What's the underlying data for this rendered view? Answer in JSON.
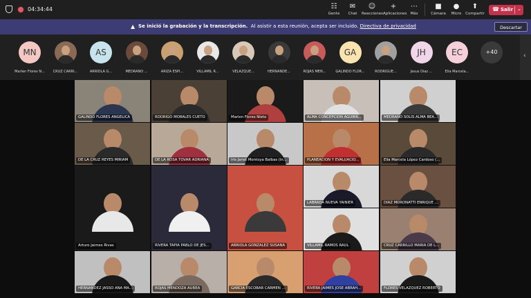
{
  "topbar": {
    "timer": "04:34:44",
    "controls": [
      {
        "label": "Gente",
        "glyph": "☷"
      },
      {
        "label": "Chat",
        "glyph": "✉"
      },
      {
        "label": "Reacciones",
        "glyph": "☺"
      },
      {
        "label": "Aplicaciones",
        "glyph": "+"
      },
      {
        "label": "Más",
        "glyph": "⋯"
      },
      {
        "label": "Cámara",
        "glyph": "■"
      },
      {
        "label": "Micro",
        "glyph": "●"
      },
      {
        "label": "Compartir",
        "glyph": "⬆"
      }
    ],
    "leave_label": "Salir"
  },
  "banner": {
    "bold": "Se inició la grabación y la transcripción.",
    "text": "Al asistir a esta reunión, acepta ser incluido.",
    "link": "Directiva de privacidad",
    "dismiss": "Descartar"
  },
  "strip": {
    "participants": [
      {
        "initials": "MN",
        "name": "Marlen Flores N...",
        "color": "#f4c7c3"
      },
      {
        "initials": "",
        "name": "CRUZ CARRI...",
        "color": "#8a6a55"
      },
      {
        "initials": "AS",
        "name": "ARRIOLA G...",
        "color": "#c7e3ec"
      },
      {
        "initials": "",
        "name": "MEDRANO ...",
        "color": "#6a4a3a"
      },
      {
        "initials": "",
        "name": "ARIZA ESPI...",
        "color": "#c9a070"
      },
      {
        "initials": "",
        "name": "VILLAMIL R...",
        "color": "#e8e8e8"
      },
      {
        "initials": "",
        "name": "VELAZQUE...",
        "color": "#d8c8b8"
      },
      {
        "initials": "",
        "name": "HERNANDE...",
        "color": "#3a3a3a"
      },
      {
        "initials": "",
        "name": "ROJAS MEN...",
        "color": "#c85a5a"
      },
      {
        "initials": "GA",
        "name": "GALINDO FLOR...",
        "color": "#f9e3b0"
      },
      {
        "initials": "",
        "name": "RODRIGUE...",
        "color": "#a0a0a0"
      },
      {
        "initials": "JH",
        "name": "Jesus Diaz ...",
        "color": "#f1d5e8"
      },
      {
        "initials": "EC",
        "name": "Elia Marcela...",
        "color": "#f5d0d8"
      }
    ],
    "more": "+40"
  },
  "tiles": [
    {
      "name": "GALINDO FLORES ANGELICA",
      "bg": "#8a8378",
      "body": "#2a3550"
    },
    {
      "name": "RODRIGO MORALES CUETO",
      "bg": "#4a4035",
      "body": "#2a2a2a"
    },
    {
      "name": "Marlen Flores Nieto",
      "bg": "#1a1a1a",
      "body": "#b04040"
    },
    {
      "name": "ALMA CONCEPCION AGUIRR...",
      "bg": "#c8c0b8",
      "body": "#e0e0e0"
    },
    {
      "name": "MEDRANO SOLIS ALMA BEA...",
      "bg": "#d0d0d0",
      "body": "#3a3a3a"
    },
    {
      "name": "DE LA CRUZ REYES MIRIAM",
      "bg": "#6a5a4a",
      "body": "#2a2a2a"
    },
    {
      "name": "DE LA ROSA TOVAR ADRIANA",
      "bg": "#b8a898",
      "body": "#a03040"
    },
    {
      "name": "Iris Janet Montoya Balbas (In...",
      "bg": "#c8c8c8",
      "body": "#202020"
    },
    {
      "name": "PLANEACION Y EVALUACIO...",
      "bg": "#b87048",
      "body": "#c03030"
    },
    {
      "name": "Elia Marcela López Cardoso (...",
      "bg": "#5a4a3a",
      "body": "#2a2a2a"
    },
    {
      "name": "LABRADA NUEVA YAINIER",
      "bg": "#d8d8d8",
      "body": "#1a1a2a"
    },
    {
      "name": "DIAZ MORONATTI ENRIQUE ...",
      "bg": "#6a5040",
      "body": "#2a2a2a"
    },
    {
      "name": "Arturo Jaimes Rivas",
      "bg": "#1a1a1a",
      "body": "#e8e8e8"
    },
    {
      "name": "RIVERA TAPIA PABLO DE JES...",
      "bg": "#2a2a3a",
      "body": "#f0f0f0"
    },
    {
      "name": "ARRIOLA GONZALEZ SUSANA",
      "bg": "#c85040",
      "body": "#3a3a3a"
    },
    {
      "name": "VILLAMIL RAMOS RAUL",
      "bg": "#e0e0e0",
      "body": "#1a1a1a"
    },
    {
      "name": "CRUZ CARRILLO MARIA DE L...",
      "bg": "#9a8070",
      "body": "#4a3a4a"
    },
    {
      "name": "HERNANDEZ JASSO ANA MA...",
      "bg": "#c0c0c0",
      "body": "#1a1a1a"
    },
    {
      "name": "ROJAS MENDOZA AUREA",
      "bg": "#b8b0a8",
      "body": "#7a6a60"
    },
    {
      "name": "GARCIA ESCOBAR CARMEN ...",
      "bg": "#d8a070",
      "body": "#2a2a2a"
    },
    {
      "name": "RIVERA JAIMES JOSE ABRAH...",
      "bg": "#c04040",
      "body": "#3040a0"
    },
    {
      "name": "FLORES VELAZQUEZ ROBERTO",
      "bg": "#d0d0d0",
      "body": "#1a1a1a"
    }
  ]
}
